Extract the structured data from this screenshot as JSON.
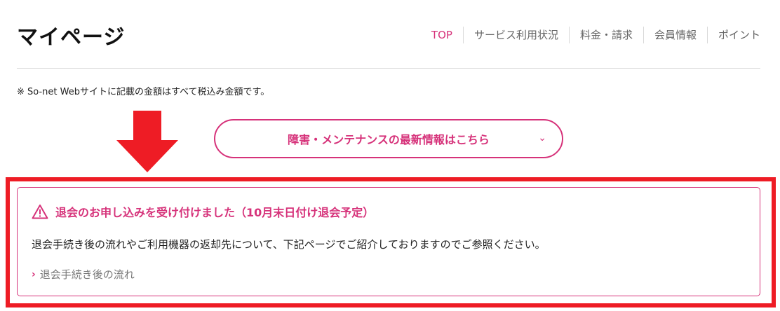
{
  "header": {
    "title": "マイページ",
    "nav": [
      {
        "label": "TOP",
        "active": true
      },
      {
        "label": "サービス利用状況",
        "active": false
      },
      {
        "label": "料金・請求",
        "active": false
      },
      {
        "label": "会員情報",
        "active": false
      },
      {
        "label": "ポイント",
        "active": false
      }
    ]
  },
  "tax_note": "※ So-net Webサイトに記載の金額はすべて税込み金額です。",
  "maintenance_button": {
    "label": "障害・メンテナンスの最新情報はこちら",
    "icon": "chevron-down-icon"
  },
  "notice": {
    "icon": "warning-icon",
    "title": "退会のお申し込みを受け付けました（10月末日付け退会予定）",
    "body": "退会手続き後の流れやご利用機器の返却先について、下記ページでご紹介しておりますのでご参照ください。",
    "link_label": "退会手続き後の流れ"
  },
  "colors": {
    "accent": "#d6327a",
    "annotation_red": "#ee1c25"
  }
}
